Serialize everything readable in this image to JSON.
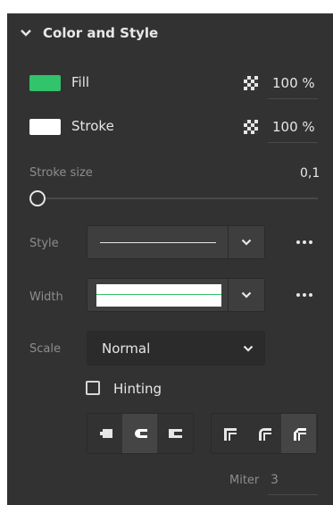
{
  "section": {
    "title": "Color and Style"
  },
  "fill": {
    "label": "Fill",
    "color": "#31c46a",
    "opacity": "100 %"
  },
  "stroke": {
    "label": "Stroke",
    "color": "#ffffff",
    "opacity": "100 %"
  },
  "stroke_size": {
    "label": "Stroke size",
    "value": "0,1",
    "slider_fraction": 0.0
  },
  "style": {
    "label": "Style"
  },
  "width": {
    "label": "Width",
    "preview_line_color": "#31c46a"
  },
  "scale": {
    "label": "Scale",
    "value": "Normal"
  },
  "hinting": {
    "label": "Hinting",
    "checked": false
  },
  "caps": {
    "options": [
      "butt-cap",
      "round-cap",
      "projecting-cap"
    ],
    "selected_index": 1
  },
  "joins": {
    "options": [
      "miter-join",
      "round-join",
      "bevel-join"
    ],
    "selected_index": 2
  },
  "miter": {
    "label": "Miter",
    "value": "3"
  },
  "colors": {
    "panel_bg": "#323232",
    "control_bg": "#3e3e3e",
    "accent_green": "#31c46a"
  }
}
